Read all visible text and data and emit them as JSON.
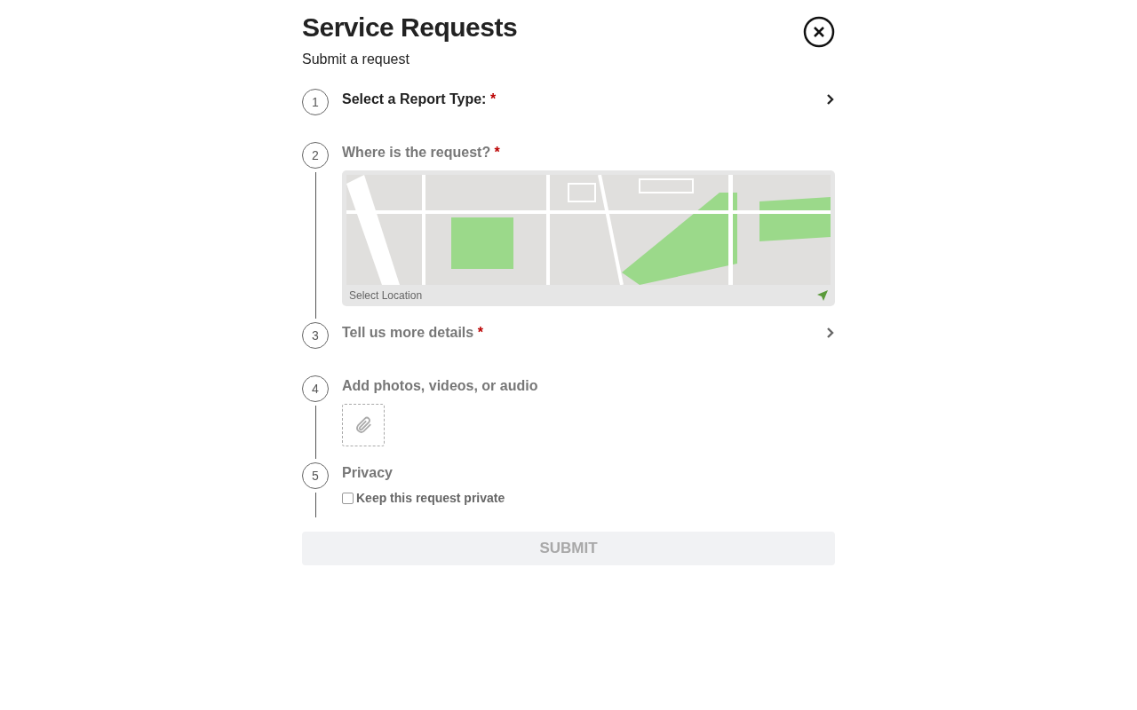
{
  "header": {
    "title": "Service Requests",
    "subtitle": "Submit a request"
  },
  "steps": [
    {
      "number": "1",
      "kind": "select",
      "label": "Select a Report Type:",
      "required_mark": "*",
      "active": true
    },
    {
      "number": "2",
      "kind": "map",
      "label": "Where is the request?",
      "required_mark": "*",
      "active": false,
      "map": {
        "kind": "picture",
        "caption": "Select Location"
      }
    },
    {
      "number": "3",
      "kind": "select",
      "label": "Tell us more details",
      "required_mark": "*",
      "active": false
    },
    {
      "number": "4",
      "kind": "attach",
      "label": "Add photos, videos, or audio",
      "active": false
    },
    {
      "number": "5",
      "kind": "privacy",
      "label": "Privacy",
      "active": false,
      "checkbox": {
        "label": "Keep this request private",
        "checked": false
      }
    }
  ],
  "submit": {
    "label": "SUBMIT",
    "disabled": true
  }
}
